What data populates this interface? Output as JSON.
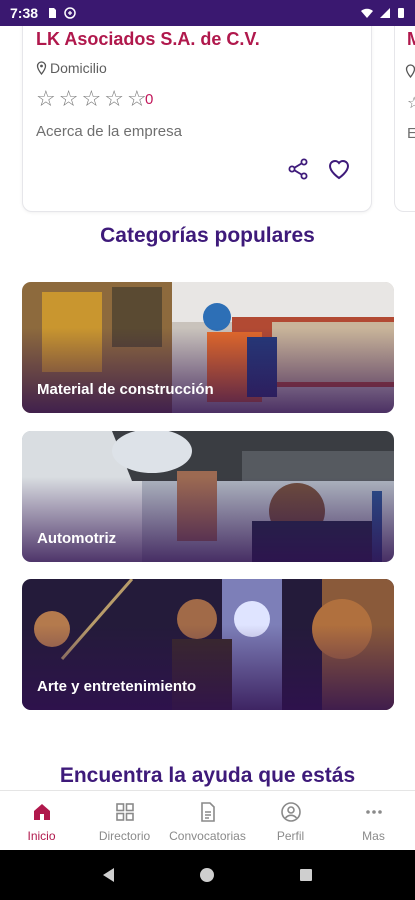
{
  "status_bar": {
    "time": "7:38"
  },
  "company": {
    "name": "LK Asociados S.A. de C.V.",
    "location": "Domicilio",
    "rating_count": "0",
    "about": "Acerca de la empresa"
  },
  "peek_card": {
    "name_initial": "M",
    "about_initial": "E"
  },
  "popular_categories": {
    "title": "Categorías populares",
    "items": [
      {
        "label": "Material de construcción"
      },
      {
        "label": "Automotriz"
      },
      {
        "label": "Arte y entretenimiento"
      }
    ]
  },
  "help_section": {
    "title": "Encuentra la ayuda que estás"
  },
  "bottom_nav": {
    "items": [
      {
        "label": "Inicio",
        "icon": "home-icon",
        "active": true
      },
      {
        "label": "Directorio",
        "icon": "grid-icon"
      },
      {
        "label": "Convocatorias",
        "icon": "document-icon"
      },
      {
        "label": "Perfil",
        "icon": "profile-icon"
      },
      {
        "label": "Mas",
        "icon": "more-icon"
      }
    ]
  },
  "colors": {
    "primary": "#3e1a7a",
    "accent": "#b0184c",
    "status_bar": "#3a1870"
  }
}
